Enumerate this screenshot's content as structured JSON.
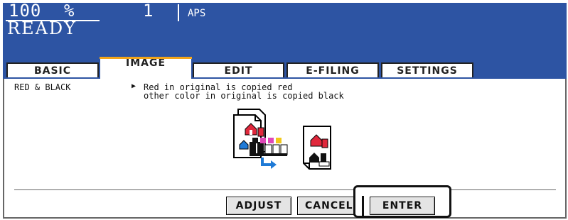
{
  "status": {
    "zoom_value": "100",
    "zoom_unit": "%",
    "copies": "1",
    "paper": "APS",
    "state": "READY"
  },
  "tabs": [
    {
      "label": "BASIC",
      "active": false
    },
    {
      "label": "IMAGE",
      "active": true
    },
    {
      "label": "EDIT",
      "active": false
    },
    {
      "label": "E-FILING",
      "active": false
    },
    {
      "label": "SETTINGS",
      "active": false
    }
  ],
  "mode": {
    "label": "RED & BLACK",
    "description_line1": "Red in original is copied red",
    "description_line2": "other color in original is copied black"
  },
  "buttons": {
    "adjust": "ADJUST",
    "cancel": "CANCEL",
    "enter": "ENTER"
  },
  "colors": {
    "header_blue": "#2d54a3",
    "active_tab_accent": "#f2a51a",
    "house_red": "#e0283c"
  },
  "icons": [
    "original-document-icon",
    "toner-cartridges-icon",
    "convert-arrow-icon",
    "output-document-icon"
  ]
}
